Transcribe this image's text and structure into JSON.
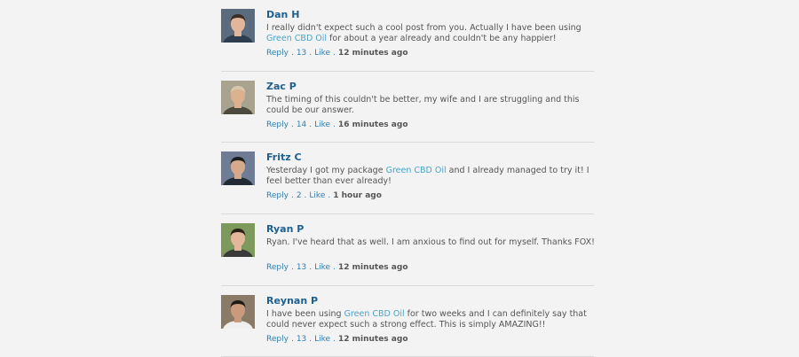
{
  "comments": [
    {
      "author": "Dan H",
      "text_before": "I really didn't expect such a cool post from you. Actually I have been using ",
      "link": "Green CBD Oil",
      "text_after": " for about a year already and couldn't be any happier!",
      "reply_label": "Reply",
      "count": "13",
      "like_label": "Like",
      "time": "12 minutes ago",
      "avatar": {
        "bg": "#5b6b7e",
        "skin": "#e1b69a",
        "hair": "#3a2e25",
        "shirt": "#2c3e50"
      }
    },
    {
      "author": "Zac P",
      "text_before": "The timing of this couldn't be better, my wife and I are struggling and this could be our answer.",
      "link": "",
      "text_after": "",
      "reply_label": "Reply",
      "count": "14",
      "like_label": "Like",
      "time": "16 minutes ago",
      "avatar": {
        "bg": "#a7a38e",
        "skin": "#dcb190",
        "hair": "#d8c7a8",
        "shirt": "#4c4a3e"
      }
    },
    {
      "author": "Fritz C",
      "text_before": "Yesterday I got my package ",
      "link": "Green CBD Oil",
      "text_after": " and I already managed to try it! I feel better than ever already!",
      "reply_label": "Reply",
      "count": "2",
      "like_label": "Like",
      "time": "1 hour ago",
      "avatar": {
        "bg": "#6f7c95",
        "skin": "#d5a98c",
        "hair": "#1c1c1c",
        "shirt": "#222a35"
      }
    },
    {
      "author": "Ryan P",
      "text_before": "Ryan. I've heard that as well. I am anxious to find out for myself. Thanks FOX!",
      "link": "",
      "text_after": "",
      "reply_label": "Reply",
      "count": "13",
      "like_label": "Like",
      "time": "12 minutes ago",
      "avatar": {
        "bg": "#7d9a5c",
        "skin": "#e2b79a",
        "hair": "#2a2018",
        "shirt": "#3a3a3a"
      }
    },
    {
      "author": "Reynan P",
      "text_before": "I have been using ",
      "link": "Green CBD Oil",
      "text_after": " for two weeks and I can definitely say that could never expect such a strong effect. This is simply AMAZING!!",
      "reply_label": "Reply",
      "count": "13",
      "like_label": "Like",
      "time": "12 minutes ago",
      "avatar": {
        "bg": "#8a7a68",
        "skin": "#c99a7c",
        "hair": "#1e1a16",
        "shirt": "#f0f0f0"
      }
    }
  ]
}
